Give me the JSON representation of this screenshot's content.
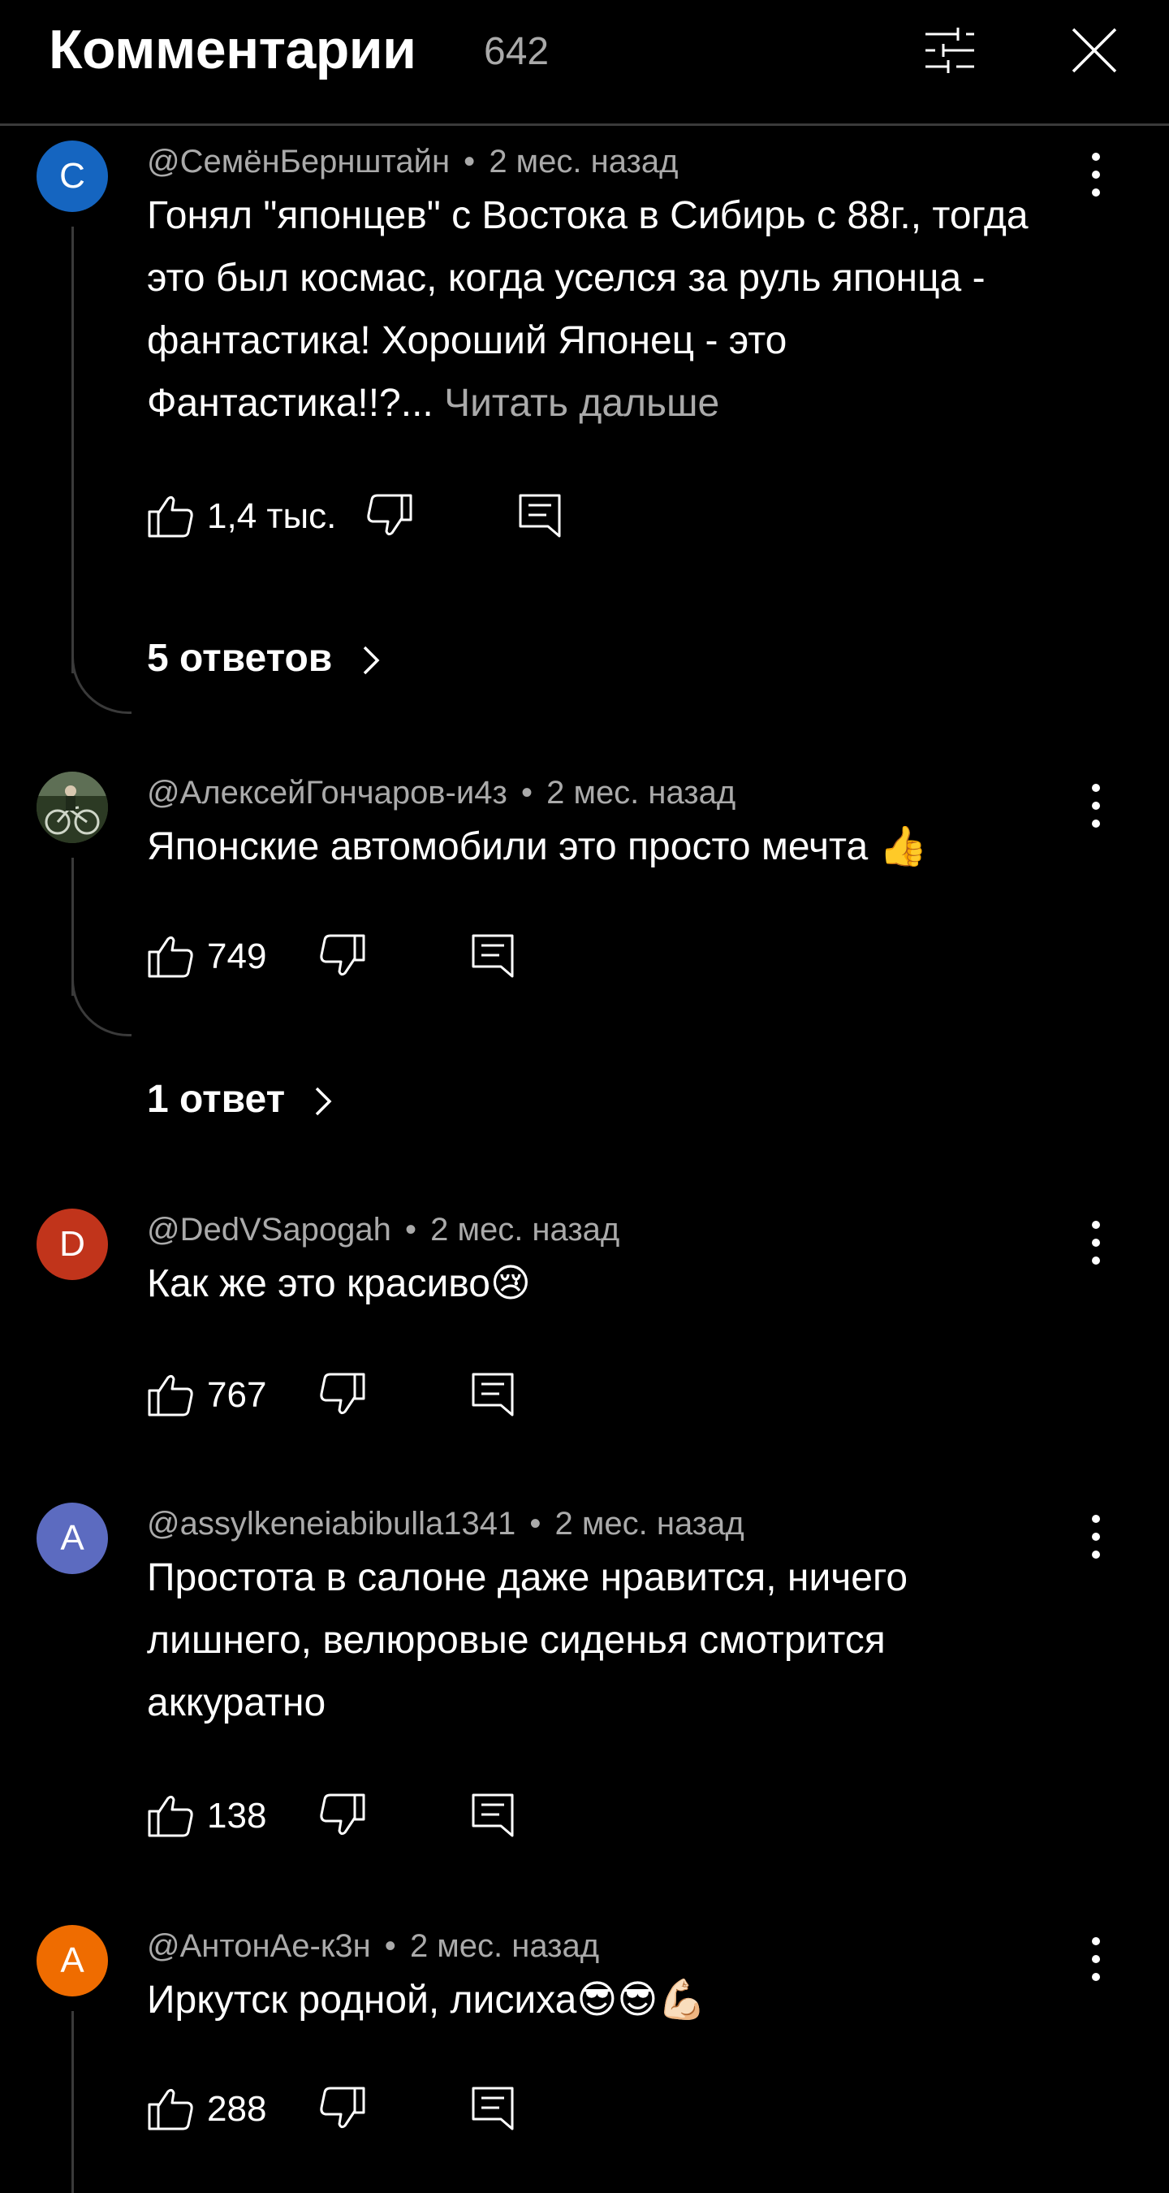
{
  "header": {
    "title": "Комментарии",
    "count": "642",
    "filter_icon": "sliders-icon",
    "close_icon": "close-icon"
  },
  "comments": [
    {
      "avatar_letter": "С",
      "avatar_color": "#1565c0",
      "author": "@СемёнБернштайн",
      "time": "2 мес. назад",
      "text": "Гонял \"японцев\" с Востока в Сибирь с 88г., тогда это был космас, когда уселся за руль японца - фантастика! Хороший Японец - это Фантастика!!?...",
      "read_more": "Читать дальше",
      "likes": "1,4 тыс.",
      "replies": "5 ответов"
    },
    {
      "avatar_letter": "",
      "avatar_color": "#4a5a3a",
      "author": "@АлексейГончаров-и4з",
      "time": "2 мес. назад",
      "text": "Японские автомобили это просто мечта 👍",
      "likes": "749",
      "replies": "1 ответ"
    },
    {
      "avatar_letter": "D",
      "avatar_color": "#c1341b",
      "author": "@DedVSapogah",
      "time": "2 мес. назад",
      "text": "Как же это красиво😢",
      "likes": "767"
    },
    {
      "avatar_letter": "A",
      "avatar_color": "#5c6bc0",
      "author": "@assylkeneiabibulla1341",
      "time": "2 мес. назад",
      "text": "Простота в салоне даже нравится, ничего лишнего, велюровые сиденья смотрится аккуратно",
      "likes": "138"
    },
    {
      "avatar_letter": "А",
      "avatar_color": "#ef6c00",
      "author": "@АнтонАе-к3н",
      "time": "2 мес. назад",
      "text": "Иркутск родной, лисиха😎😎💪🏻",
      "likes": "288"
    }
  ],
  "separator": "•",
  "icons": [
    "thumbs-up-icon",
    "thumbs-down-icon",
    "reply-icon",
    "more-vert-icon",
    "chevron-right-icon"
  ]
}
